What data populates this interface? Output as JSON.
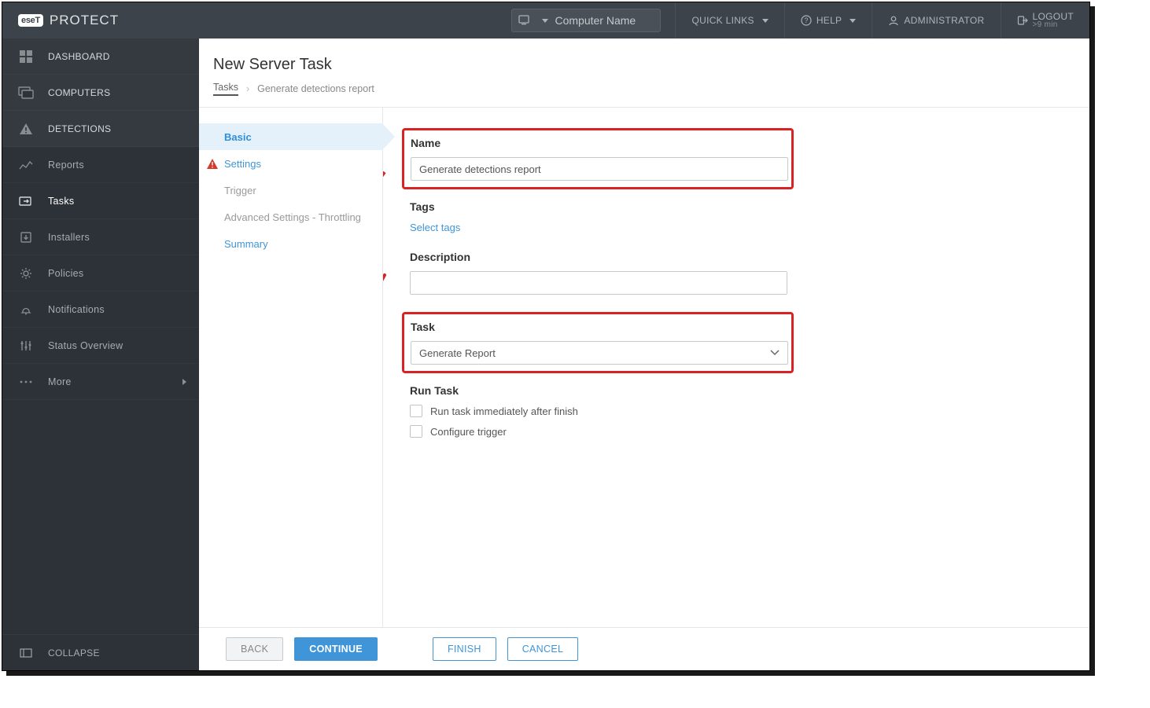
{
  "brand": {
    "badge": "eseT",
    "name": "PROTECT"
  },
  "topbar": {
    "search_placeholder": "Computer Name",
    "quick_links": "QUICK LINKS",
    "help": "HELP",
    "admin": "ADMINISTRATOR",
    "logout": "LOGOUT",
    "logout_sub": ">9 min"
  },
  "sidebar": {
    "items": [
      {
        "label": "DASHBOARD"
      },
      {
        "label": "COMPUTERS"
      },
      {
        "label": "DETECTIONS"
      },
      {
        "label": "Reports"
      },
      {
        "label": "Tasks"
      },
      {
        "label": "Installers"
      },
      {
        "label": "Policies"
      },
      {
        "label": "Notifications"
      },
      {
        "label": "Status Overview"
      },
      {
        "label": "More"
      }
    ],
    "collapse": "COLLAPSE"
  },
  "page": {
    "title": "New Server Task",
    "breadcrumbs": {
      "root": "Tasks",
      "current": "Generate detections report"
    }
  },
  "steps": [
    {
      "label": "Basic",
      "state": "active"
    },
    {
      "label": "Settings",
      "state": "link",
      "warn": true
    },
    {
      "label": "Trigger",
      "state": "disabled"
    },
    {
      "label": "Advanced Settings - Throttling",
      "state": "disabled"
    },
    {
      "label": "Summary",
      "state": "link"
    }
  ],
  "form": {
    "name_label": "Name",
    "name_value": "Generate detections report",
    "tags_label": "Tags",
    "tags_link": "Select tags",
    "description_label": "Description",
    "description_value": "",
    "task_label": "Task",
    "task_value": "Generate Report",
    "runtask_label": "Run Task",
    "run_immediately": "Run task immediately after finish",
    "configure_trigger": "Configure trigger"
  },
  "footer": {
    "back": "BACK",
    "continue": "CONTINUE",
    "finish": "FINISH",
    "cancel": "CANCEL"
  }
}
